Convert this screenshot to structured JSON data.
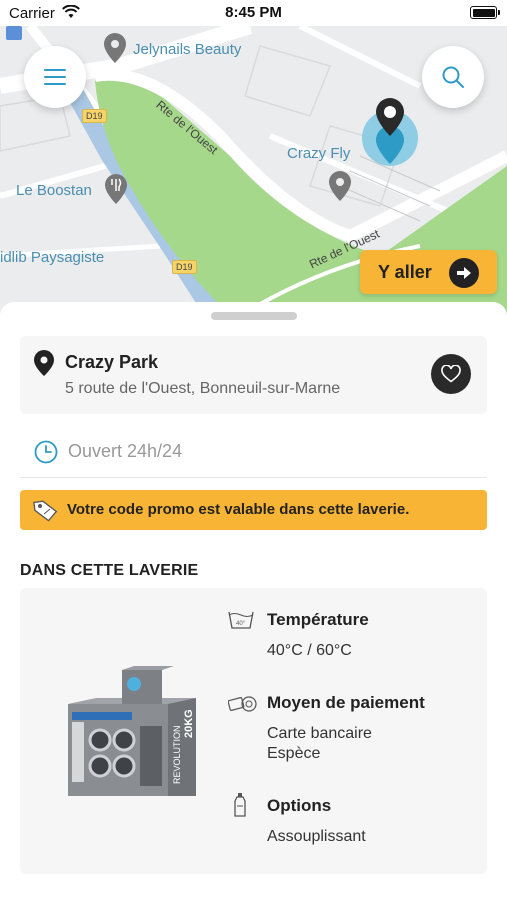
{
  "status_bar": {
    "carrier": "Carrier",
    "time": "8:45 PM"
  },
  "map": {
    "pois": [
      {
        "name": "Jelynails Beauty"
      },
      {
        "name": "Crazy Fly"
      },
      {
        "name": "Le Boostan"
      },
      {
        "name": "idlib Paysagiste"
      }
    ],
    "roads": [
      {
        "name": "Rte de l'Ouest"
      },
      {
        "name": "Rte de l'Ouest"
      }
    ],
    "road_badges": [
      "D19",
      "D19"
    ],
    "go_button_label": "Y aller"
  },
  "place": {
    "name": "Crazy Park",
    "address": "5 route de l'Ouest, Bonneuil-sur-Marne",
    "hours": "Ouvert 24h/24"
  },
  "promo": {
    "text": "Votre code promo est valable dans cette laverie."
  },
  "section": {
    "title": "DANS CETTE LAVERIE"
  },
  "features": [
    {
      "icon": "temperature-icon",
      "title": "Température",
      "values": [
        "40°C / 60°C"
      ]
    },
    {
      "icon": "payment-icon",
      "title": "Moyen de paiement",
      "values": [
        "Carte bancaire",
        "Espèce"
      ]
    },
    {
      "icon": "options-icon",
      "title": "Options",
      "values": [
        "Assouplissant"
      ]
    }
  ],
  "machine_image": {
    "brand_text": "REVOLUTION",
    "size_text": "20KG"
  },
  "colors": {
    "accent": "#f8b434",
    "map_park": "#a5d88a",
    "map_water": "#aac8e4",
    "map_label": "#4a8fb0",
    "dark": "#2a2a2a",
    "pin_blue": "#2e9bc6"
  }
}
